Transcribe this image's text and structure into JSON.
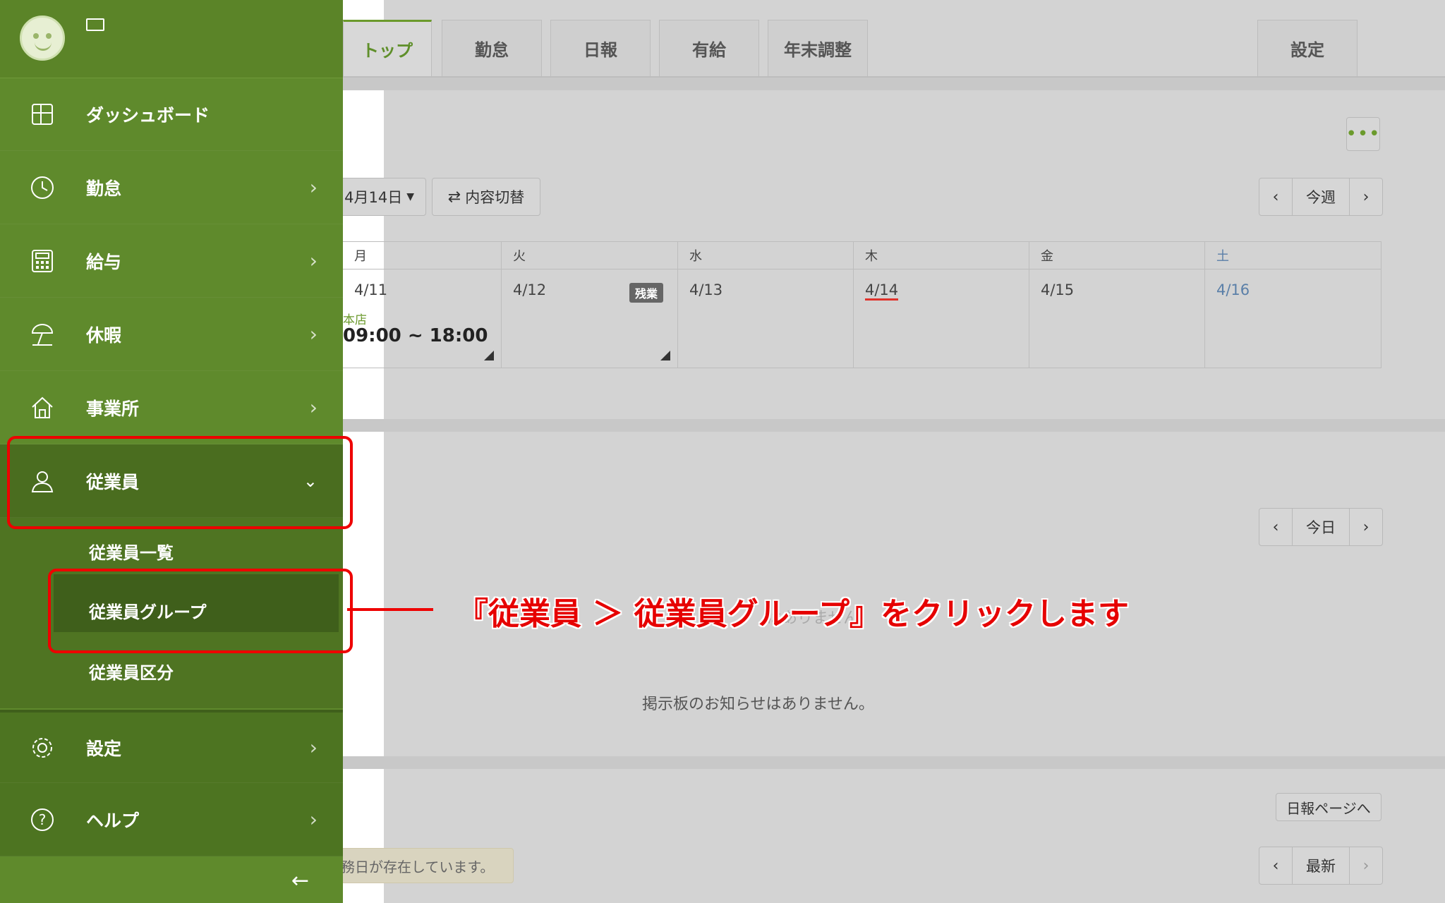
{
  "tabs": [
    "トップ",
    "勤怠",
    "日報",
    "有給",
    "年末調整"
  ],
  "settings_tab": "設定",
  "week_bar": {
    "date_picker": "4月14日",
    "switch_button": "内容切替",
    "nav_today": "今週"
  },
  "calendar": {
    "days": [
      {
        "head": "月",
        "date": "4/11",
        "shop": "本店",
        "time": "09:00 ~ 18:00"
      },
      {
        "head": "火",
        "date": "4/12",
        "badge": "残業"
      },
      {
        "head": "水",
        "date": "4/13"
      },
      {
        "head": "木",
        "date": "4/14"
      },
      {
        "head": "金",
        "date": "4/15"
      },
      {
        "head": "土",
        "date": "4/16"
      }
    ]
  },
  "board": {
    "nav_today": "今日",
    "empty_message": "掲示板のお知らせはありません。",
    "ghost_text": "はありません"
  },
  "report": {
    "link": "日報ページへ",
    "nav_latest": "最新",
    "notice": "務日が存在しています。"
  },
  "sidebar": {
    "items": [
      {
        "label": "ダッシュボード",
        "icon": "dashboard-icon"
      },
      {
        "label": "勤怠",
        "icon": "clock-icon"
      },
      {
        "label": "給与",
        "icon": "calculator-icon"
      },
      {
        "label": "休暇",
        "icon": "beach-umbrella-icon"
      },
      {
        "label": "事業所",
        "icon": "home-icon"
      },
      {
        "label": "従業員",
        "icon": "person-icon"
      }
    ],
    "sub_items": [
      "従業員一覧",
      "従業員グループ",
      "従業員区分"
    ],
    "bottom_items": [
      {
        "label": "設定",
        "icon": "gear-icon"
      },
      {
        "label": "ヘルプ",
        "icon": "help-icon"
      }
    ]
  },
  "annotation": {
    "text": "『従業員 ＞ 従業員グループ』をクリックします",
    "color": "#e60000"
  }
}
